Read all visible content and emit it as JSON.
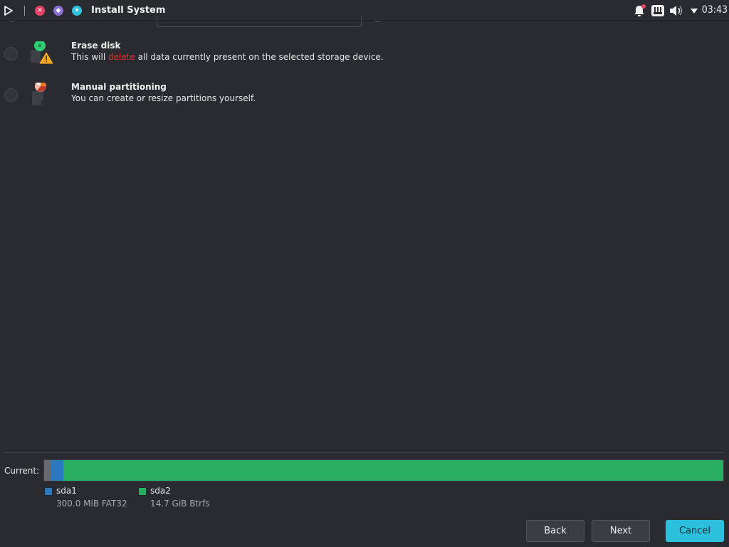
{
  "window": {
    "title": "Install System"
  },
  "tray": {
    "clock": "03:43",
    "icons": [
      "notification-bell-icon",
      "network-icon",
      "volume-icon",
      "menu-down-icon"
    ]
  },
  "options": [
    {
      "id": "erase",
      "title": "Erase disk",
      "desc_before": "This will ",
      "desc_danger": "delete",
      "desc_after": " all data currently present on the selected storage device.",
      "icon": "erase-disk-warning-icon"
    },
    {
      "id": "manual",
      "title": "Manual partitioning",
      "desc": "You can create or resize partitions yourself.",
      "icon": "manual-partition-icon"
    }
  ],
  "partitions": {
    "current_label": "Current:",
    "bar_fractions": {
      "unallocated": 0.009,
      "sda1": 0.019,
      "sda2": 0.972
    },
    "items": [
      {
        "name": "sda1",
        "size": "300.0 MiB  FAT32",
        "color": "#2b7ac0"
      },
      {
        "name": "sda2",
        "size": "14.7 GiB  Btrfs",
        "color": "#27ae60"
      }
    ],
    "unallocated_color": "#6a6a6a"
  },
  "buttons": {
    "back": "Back",
    "next": "Next",
    "cancel": "Cancel"
  },
  "colors": {
    "accent": "#2cc0dd",
    "danger": "#e02d2d",
    "background": "#2a2b30"
  }
}
